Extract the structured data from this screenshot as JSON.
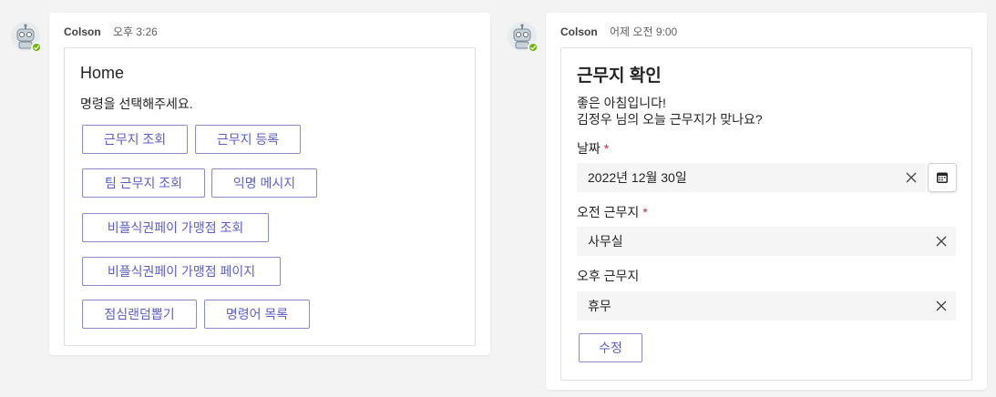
{
  "messages": [
    {
      "sender": "Colson",
      "time": "오후 3:26",
      "card": {
        "title": "Home",
        "text": "명령을 선택해주세요.",
        "buttons": [
          "근무지 조회",
          "근무지 등록",
          "팀 근무지 조회",
          "익명 메시지",
          "비플식권페이 가맹점 조회",
          "비플식권페이 가맹점 페이지",
          "점심랜덤뽑기",
          "명령어 목록"
        ]
      }
    },
    {
      "sender": "Colson",
      "time": "어제 오전 9:00",
      "card": {
        "title": "근무지 확인",
        "greeting": "좋은 아침입니다!",
        "question": "김정우 님의 오늘 근무지가 맞나요?",
        "date_label": "날짜",
        "date_value": "2022년 12월 30일",
        "morning_label": "오전 근무지",
        "morning_value": "사무실",
        "afternoon_label": "오후 근무지",
        "afternoon_value": "휴무",
        "required_mark": "*",
        "edit_button": "수정"
      }
    }
  ],
  "colors": {
    "page_bg": "#f3f3f3",
    "button_text": "#5b5fc7",
    "button_border": "#8b8cc7",
    "required": "#c4314b",
    "presence": "#6bb700"
  },
  "icons": {
    "avatar": "robot-avatar-icon",
    "presence": "available-check-icon",
    "clear": "close-icon",
    "calendar": "calendar-icon"
  }
}
